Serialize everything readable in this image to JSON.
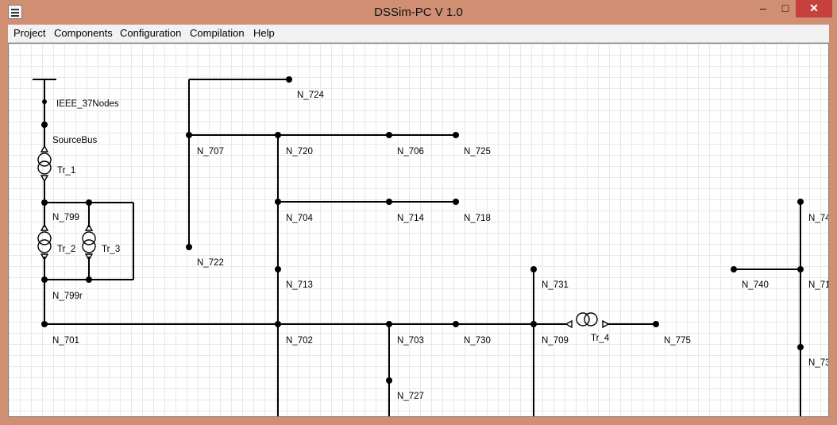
{
  "window": {
    "title": "DSSim-PC V 1.0",
    "minimize_glyph": "–",
    "maximize_glyph": "□",
    "close_glyph": "✕"
  },
  "menu": [
    {
      "id": "project",
      "label": "Project"
    },
    {
      "id": "components",
      "label": "Components"
    },
    {
      "id": "configuration",
      "label": "Configuration"
    },
    {
      "id": "compilation",
      "label": "Compilation"
    },
    {
      "id": "help",
      "label": "Help"
    }
  ],
  "diagram": {
    "nodes": [
      {
        "id": "IEEE_37Nodes",
        "label": "IEEE_37Nodes"
      },
      {
        "id": "SourceBus",
        "label": "SourceBus"
      },
      {
        "id": "N_799",
        "label": "N_799"
      },
      {
        "id": "N_799r",
        "label": "N_799r"
      },
      {
        "id": "N_701",
        "label": "N_701"
      },
      {
        "id": "N_724",
        "label": "N_724"
      },
      {
        "id": "N_707",
        "label": "N_707"
      },
      {
        "id": "N_720",
        "label": "N_720"
      },
      {
        "id": "N_706",
        "label": "N_706"
      },
      {
        "id": "N_725",
        "label": "N_725"
      },
      {
        "id": "N_704",
        "label": "N_704"
      },
      {
        "id": "N_714",
        "label": "N_714"
      },
      {
        "id": "N_718",
        "label": "N_718"
      },
      {
        "id": "N_722",
        "label": "N_722"
      },
      {
        "id": "N_713",
        "label": "N_713"
      },
      {
        "id": "N_731",
        "label": "N_731"
      },
      {
        "id": "N_740",
        "label": "N_740"
      },
      {
        "id": "N_702",
        "label": "N_702"
      },
      {
        "id": "N_703",
        "label": "N_703"
      },
      {
        "id": "N_730",
        "label": "N_730"
      },
      {
        "id": "N_709",
        "label": "N_709"
      },
      {
        "id": "N_775",
        "label": "N_775"
      },
      {
        "id": "N_727",
        "label": "N_727"
      },
      {
        "id": "N_74x",
        "label": "N_74"
      },
      {
        "id": "N_71x",
        "label": "N_71"
      },
      {
        "id": "N_73x",
        "label": "N_73"
      }
    ],
    "transformers": [
      {
        "id": "Tr_1",
        "label": "Tr_1"
      },
      {
        "id": "Tr_2",
        "label": "Tr_2"
      },
      {
        "id": "Tr_3",
        "label": "Tr_3"
      },
      {
        "id": "Tr_4",
        "label": "Tr_4"
      }
    ],
    "colors": {
      "line": "#000000",
      "background": "#ffffff",
      "grid": "#e8e8e8"
    }
  }
}
